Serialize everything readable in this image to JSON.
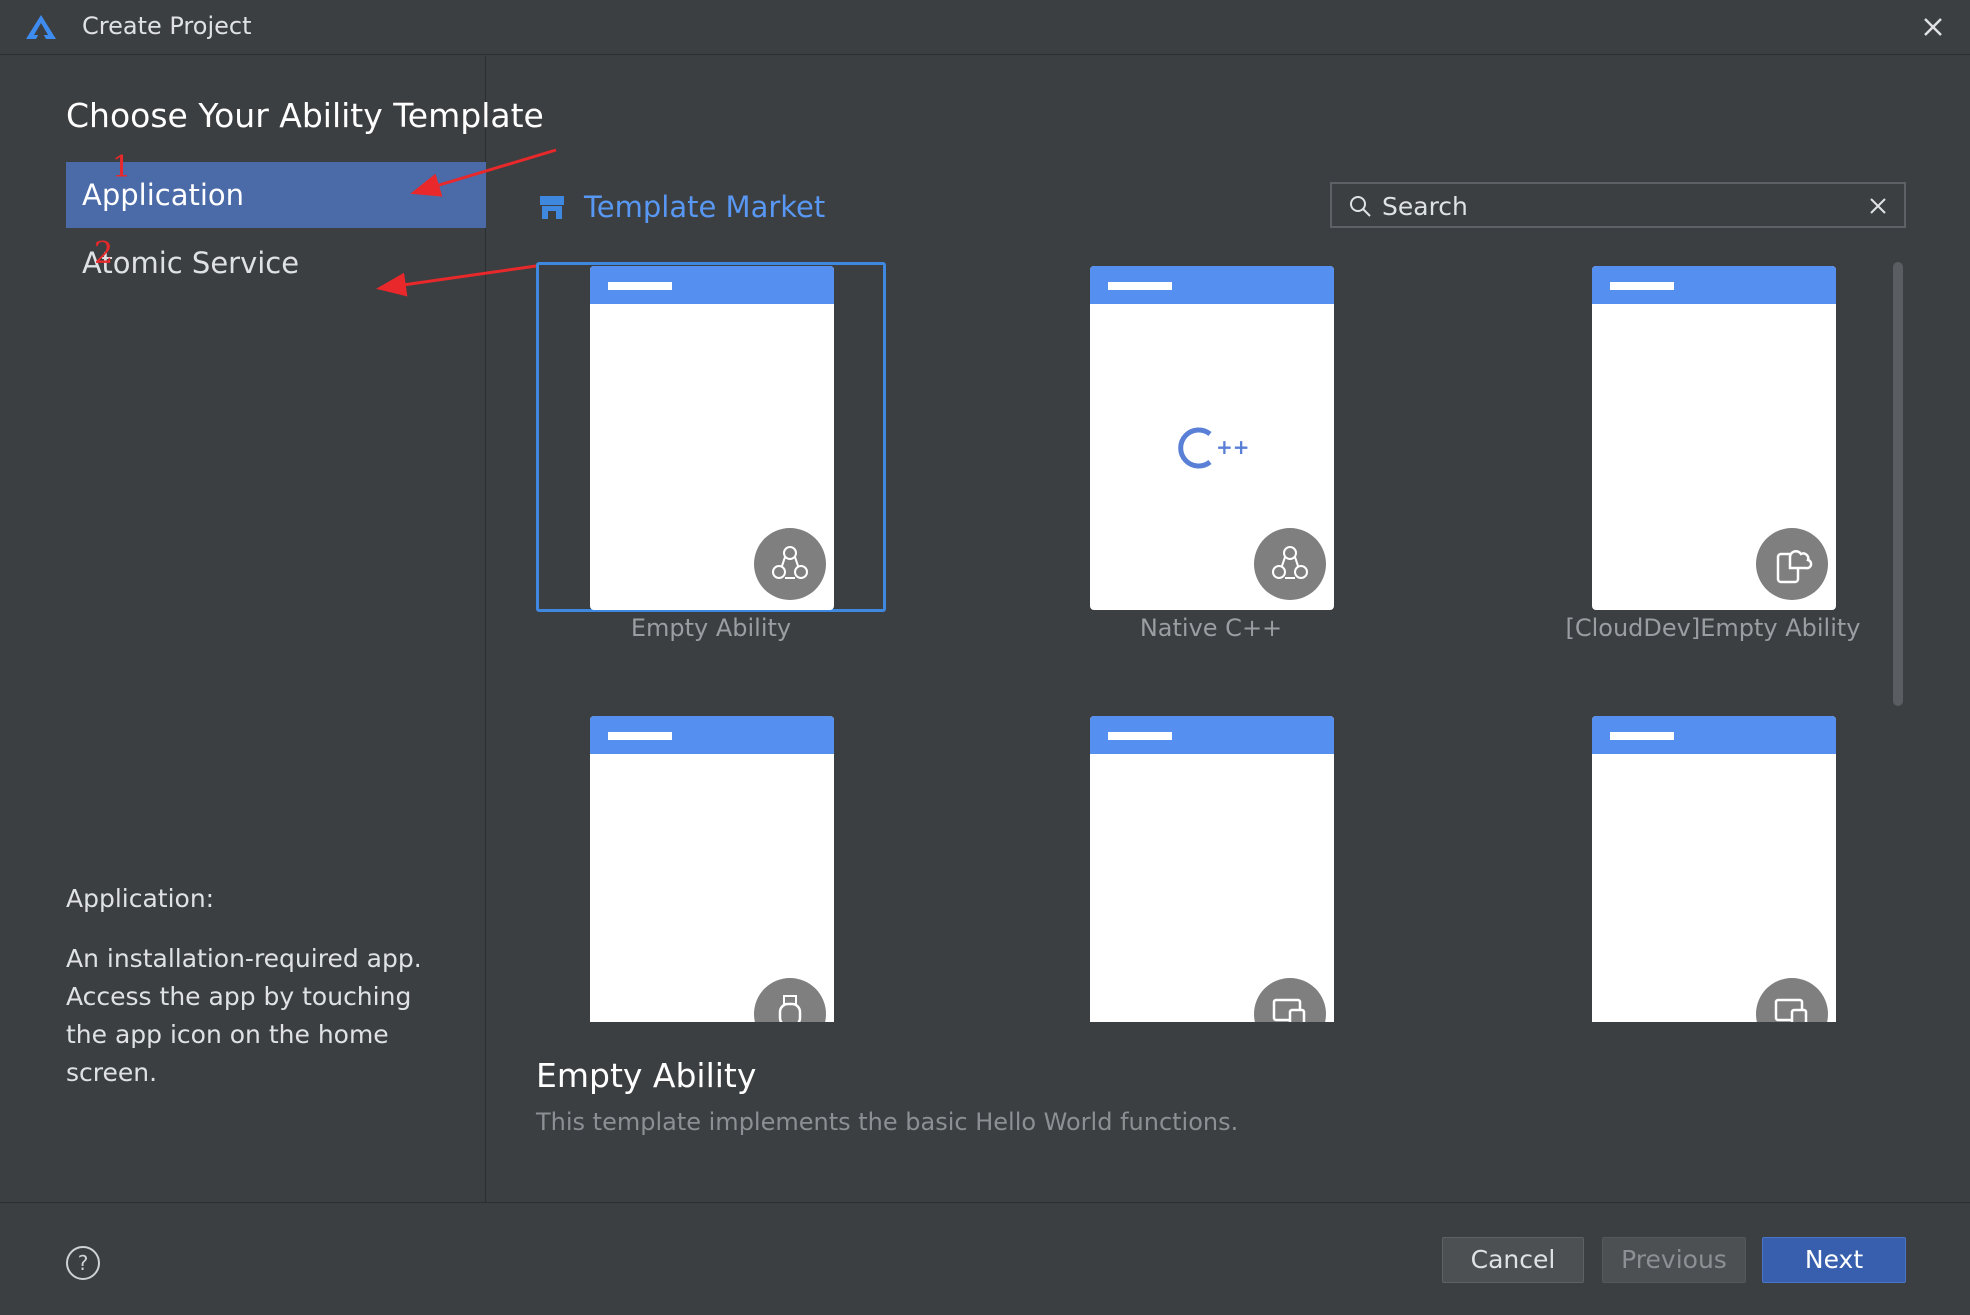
{
  "window": {
    "title": "Create Project"
  },
  "heading": "Choose Your Ability Template",
  "nav": {
    "items": [
      {
        "label": "Application",
        "active": true
      },
      {
        "label": "Atomic Service",
        "active": false
      }
    ]
  },
  "description": {
    "title": "Application:",
    "body": "An installation-required app. Access the app by touching the app icon on the home screen."
  },
  "market": {
    "label": "Template Market",
    "icon": "store-icon"
  },
  "search": {
    "placeholder": "Search",
    "value": ""
  },
  "templates": [
    {
      "label": "Empty Ability",
      "badge": "ability-icon",
      "selected": true
    },
    {
      "label": "Native C++",
      "badge": "ability-icon",
      "center_icon": "cpp-icon",
      "selected": false
    },
    {
      "label": "[CloudDev]Empty Ability",
      "badge": "cloud-device-icon",
      "selected": false
    },
    {
      "label": "",
      "badge": "watch-icon",
      "selected": false
    },
    {
      "label": "",
      "badge": "multi-device-icon",
      "selected": false
    },
    {
      "label": "",
      "badge": "multi-device-icon",
      "selected": false
    }
  ],
  "detail": {
    "title": "Empty Ability",
    "description": "This template implements the basic Hello World functions."
  },
  "footer": {
    "help": "?",
    "cancel_label": "Cancel",
    "previous_label": "Previous",
    "next_label": "Next"
  },
  "annotations": [
    "1",
    "2"
  ],
  "colors": {
    "background": "#3c3f41",
    "accent": "#5898f4",
    "selected_nav": "#4a6aa8",
    "primary_button": "#375fad",
    "tile_bar": "#5590f0",
    "annotation": "#e8282b"
  }
}
